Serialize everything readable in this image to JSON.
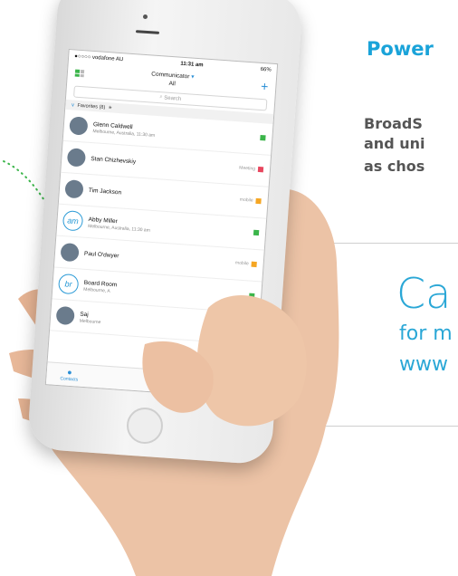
{
  "background": {
    "heading": "Power",
    "body_lines": [
      "BroadS",
      "and uni",
      "as chos"
    ],
    "cta_big": "Ca",
    "cta_line1": "for m",
    "cta_line2": "www"
  },
  "phone": {
    "status": {
      "carrier": "●○○○○ vodafone AU",
      "time": "11:31 am",
      "battery": "66%"
    },
    "header": {
      "title": "Communicator",
      "subtitle": "All"
    },
    "search_placeholder": "Search",
    "favorites_label": "Favorites (8)",
    "contacts": [
      {
        "name": "Glenn Caldwell",
        "sub": "Melbourne, Australia, 11:30 am",
        "status_text": "",
        "status_color": "#3bb54a"
      },
      {
        "name": "Stan Chizhevskiy",
        "sub": "",
        "status_text": "Meeting",
        "status_color": "#e8475f"
      },
      {
        "name": "Tim Jackson",
        "sub": "",
        "status_text": "mobile",
        "status_color": "#f5a623"
      },
      {
        "name": "Abby Miller",
        "sub": "Melbourne, Australia, 11:30 am",
        "status_text": "",
        "status_color": "#3bb54a",
        "initials": "am"
      },
      {
        "name": "Paul O'dwyer",
        "sub": "",
        "status_text": "mobile",
        "status_color": "#f5a623"
      },
      {
        "name": "Board Room",
        "sub": "Melbourne, A",
        "status_text": "",
        "status_color": "#3bb54a",
        "initials": "br"
      },
      {
        "name": "Saj",
        "sub": "Melbourne",
        "status_text": "",
        "status_color": ""
      }
    ],
    "tabs": {
      "contacts": "Contacts"
    }
  }
}
